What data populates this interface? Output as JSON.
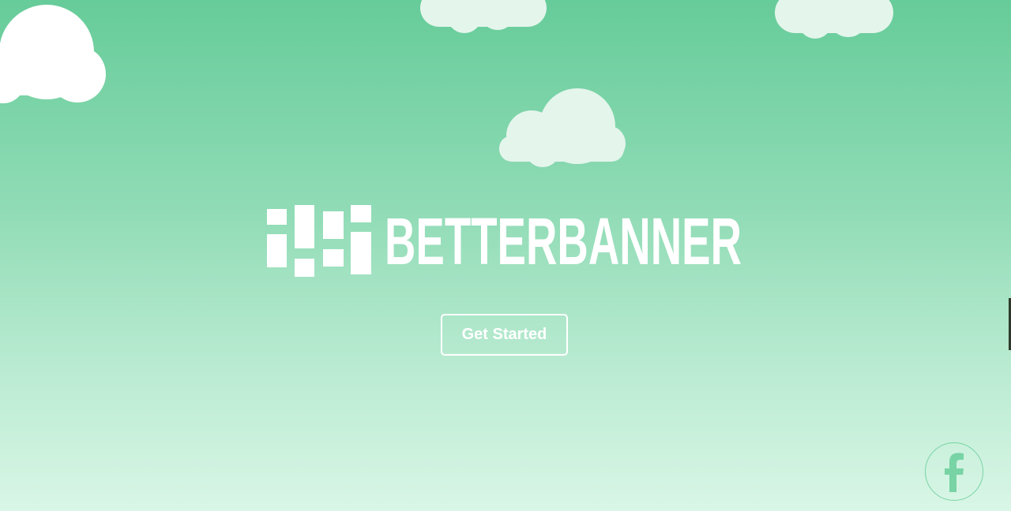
{
  "brand": {
    "name": "BETTERBANNER",
    "word_one": "BETTER",
    "word_two": "BANNER"
  },
  "hero": {
    "cta_label": "Get Started"
  },
  "social": {
    "facebook_icon": "facebook-icon"
  },
  "colors": {
    "sky_top": "#66cc99",
    "sky_bottom": "#d9f6e6",
    "cloud_white": "#ffffff",
    "cloud_pale": "#e4f5ec",
    "foreground": "#ffffff",
    "facebook_icon": "#78d3a5"
  }
}
